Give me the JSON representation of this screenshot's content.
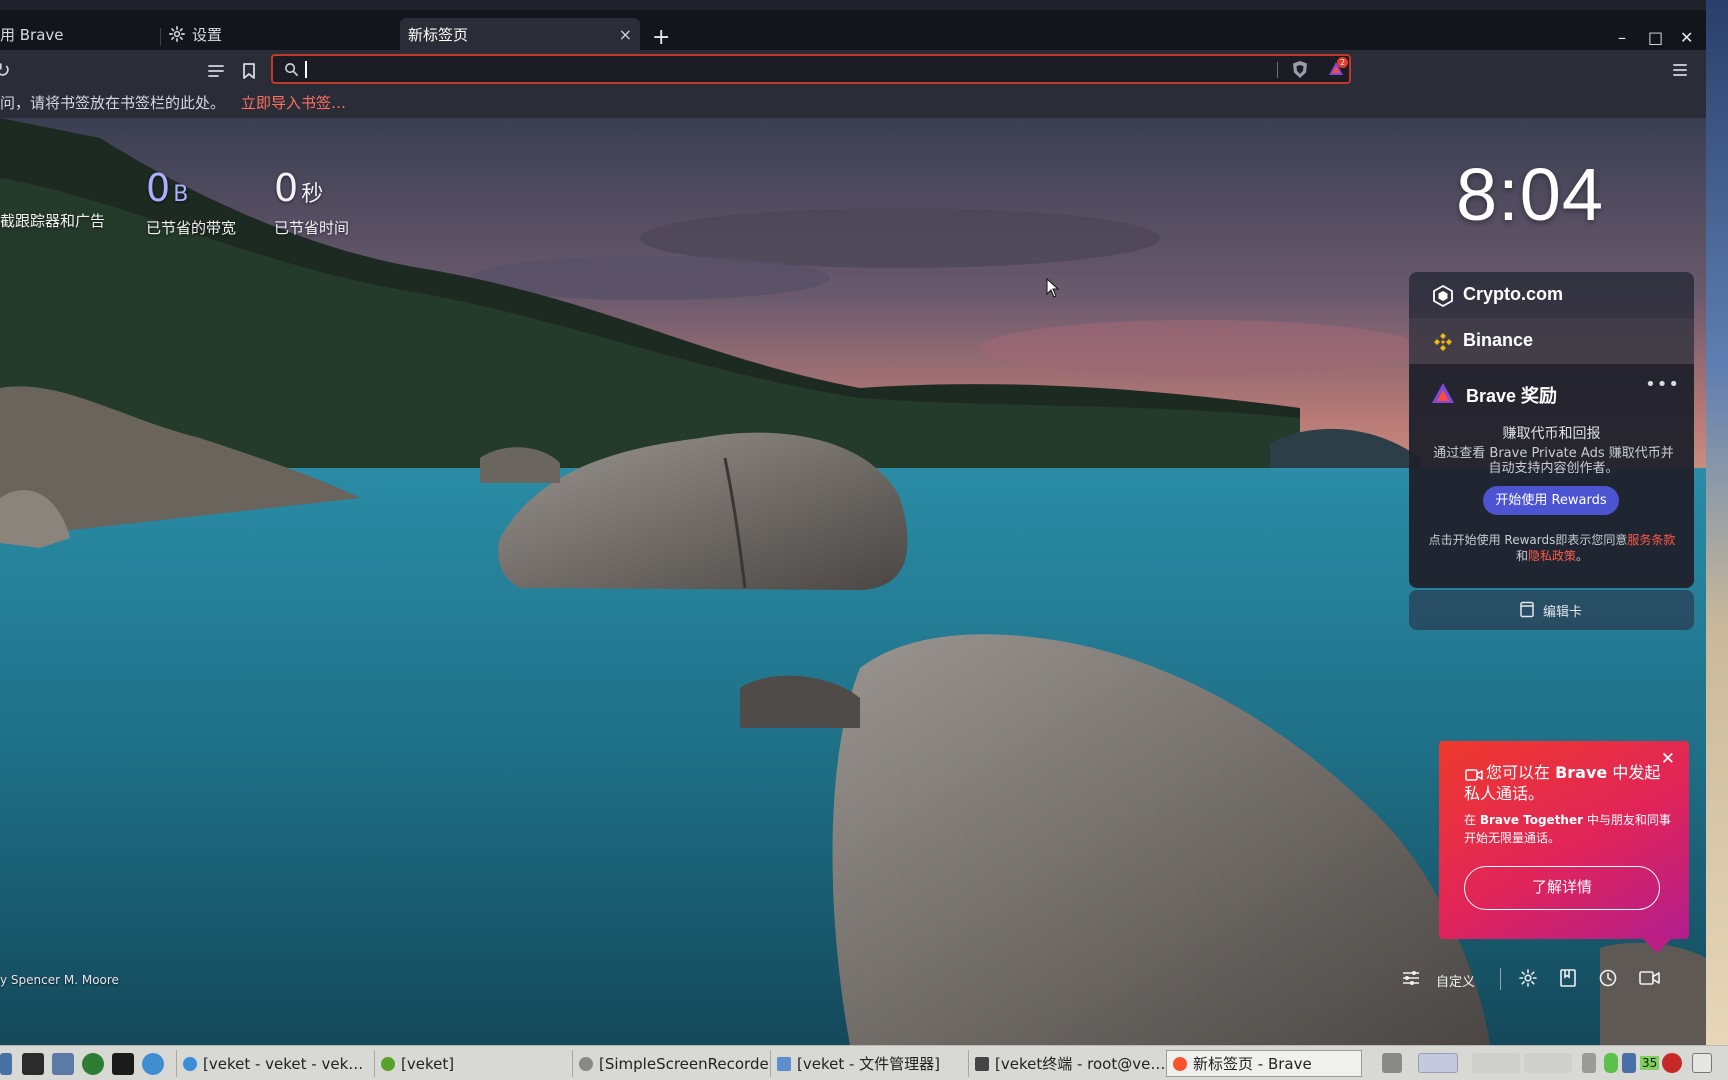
{
  "tabs": [
    {
      "label": "用 Brave",
      "icon": "brave-icon"
    },
    {
      "label": "设置",
      "icon": "gear-icon"
    },
    {
      "label": "新标签页",
      "active": true
    }
  ],
  "window_controls": {
    "minimize": "–",
    "maximize": "□",
    "close": "✕"
  },
  "new_tab_symbol": "+",
  "tab_close_symbol": "×",
  "toolbar": {
    "reload_symbol": "↻",
    "omnibox_value": ""
  },
  "shields_badge_count": "2",
  "bookmarks_bar": {
    "hint": "问，请将书签放在书签栏的此处。",
    "import_link": "立即导入书签…"
  },
  "stats": [
    {
      "value": "",
      "unit": "",
      "label": "截跟踪器和广告"
    },
    {
      "value": "0",
      "unit": "B",
      "label": "已节省的带宽"
    },
    {
      "value": "0",
      "unit": "秒",
      "label": "已节省时间"
    }
  ],
  "clock": "8:04",
  "widgets": {
    "crypto_com": "Crypto.com",
    "binance": "Binance",
    "rewards": {
      "title": "Brave 奖励",
      "more": "•••",
      "subtitle": "赚取代币和回报",
      "description": "通过查看 Brave Private Ads 赚取代币并自动支持内容创作者。",
      "button": "开始使用 Rewards",
      "legal_prefix": "点击开始使用 Rewards即表示您同意",
      "terms": "服务条款",
      "and": "和",
      "privacy": "隐私政策",
      "period": "。"
    },
    "edit_cards": "编辑卡"
  },
  "together_popup": {
    "close": "✕",
    "headline_part1": "您可以在 ",
    "headline_bold": "Brave",
    "headline_part2": " 中发起私人通话。",
    "body_prefix": "在 ",
    "body_bold": "Brave Together",
    "body_suffix": " 中与朋友和同事开始无限量通话。",
    "button": "了解详情"
  },
  "photo_credit": "y Spencer M. Moore",
  "bottom_tools": {
    "customize": "自定义"
  },
  "taskbar": {
    "items": [
      {
        "label": "[veket - veket - vek…",
        "icon_color": "#3a8fd6"
      },
      {
        "label": "[veket]",
        "icon_color": "#5aa02c"
      },
      {
        "label": "[SimpleScreenRecorder]",
        "icon_color": "#888888"
      },
      {
        "label": "[veket - 文件管理器]",
        "icon_color": "#5b8fd0"
      },
      {
        "label": "[veket终端 - root@ve…",
        "icon_color": "#444444"
      },
      {
        "label": "新标签页 - Brave",
        "icon_color": "#fb542b",
        "active": true
      }
    ],
    "tray_number": "35"
  },
  "colors": {
    "accent_red": "#ff5a4a",
    "rewards_button": "#4c54d2",
    "popup_start": "#ef3a2c",
    "popup_end": "#b21e8e"
  }
}
